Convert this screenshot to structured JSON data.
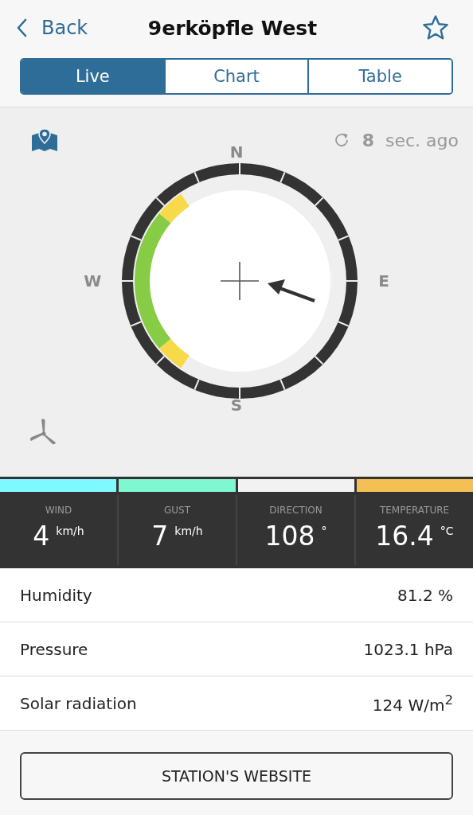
{
  "nav": {
    "back": "Back",
    "title": "9erköpfle West"
  },
  "tabs": [
    {
      "label": "Live",
      "selected": true
    },
    {
      "label": "Chart",
      "selected": false
    },
    {
      "label": "Table",
      "selected": false
    }
  ],
  "live": {
    "updated_value": "8",
    "updated_unit": "sec. ago",
    "compass": {
      "north": "N",
      "east": "E",
      "south": "S",
      "west": "W"
    }
  },
  "stats": [
    {
      "label": "WIND",
      "value": "4",
      "unit": "km/h",
      "color": "#7ff8ff"
    },
    {
      "label": "GUST",
      "value": "7",
      "unit": "km/h",
      "color": "#7ff7d0"
    },
    {
      "label": "DIRECTION",
      "value": "108",
      "unit": "°",
      "color": "#f2f2f2"
    },
    {
      "label": "TEMPERATURE",
      "value": "16.4",
      "unit": "°C",
      "color": "#f4c055"
    }
  ],
  "details": [
    {
      "label": "Humidity",
      "value": "81.2 %"
    },
    {
      "label": "Pressure",
      "value": "1023.1 hPa"
    },
    {
      "label": "Solar radiation",
      "value": "124 W/m$^{2}$"
    }
  ],
  "website_button": "STATION'S WEBSITE"
}
